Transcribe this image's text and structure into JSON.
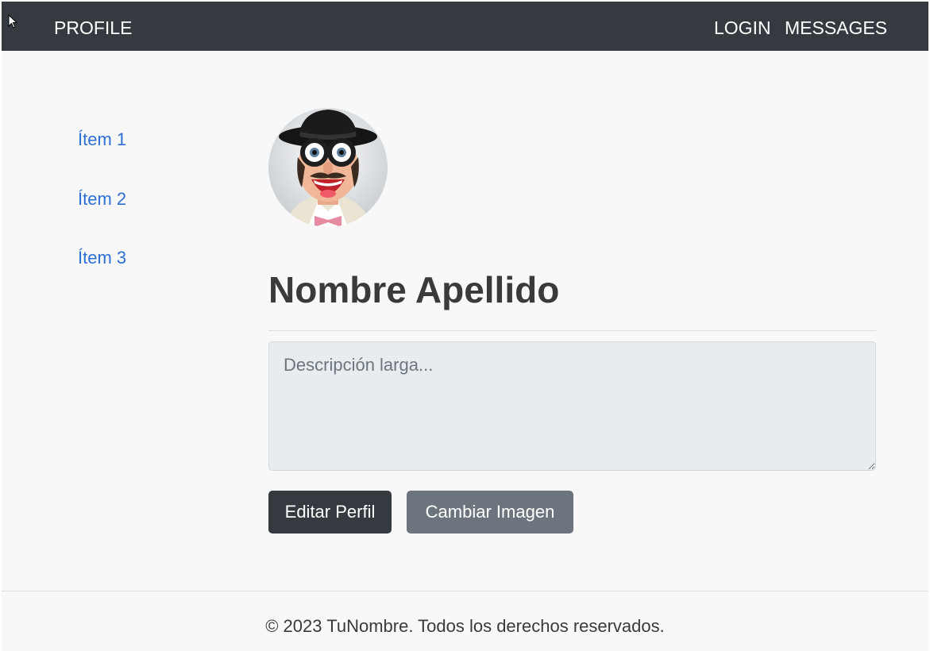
{
  "navbar": {
    "brand": "PROFILE",
    "links": [
      "LOGIN",
      "MESSAGES"
    ]
  },
  "sidebar": {
    "items": [
      {
        "label": "Ítem 1"
      },
      {
        "label": "Ítem 2"
      },
      {
        "label": "Ítem 3"
      }
    ]
  },
  "profile": {
    "name": "Nombre Apellido",
    "avatar_icon": "avatar-illustration",
    "description_value": "",
    "description_placeholder": "Descripción larga...",
    "edit_button": "Editar Perfil",
    "change_image_button": "Cambiar Imagen"
  },
  "footer": {
    "text": "© 2023 TuNombre. Todos los derechos reservados."
  },
  "colors": {
    "navbar_bg": "#343a40",
    "link": "#2e6fd4",
    "primary_button": "#343a40",
    "secondary_button": "#6c757d"
  }
}
